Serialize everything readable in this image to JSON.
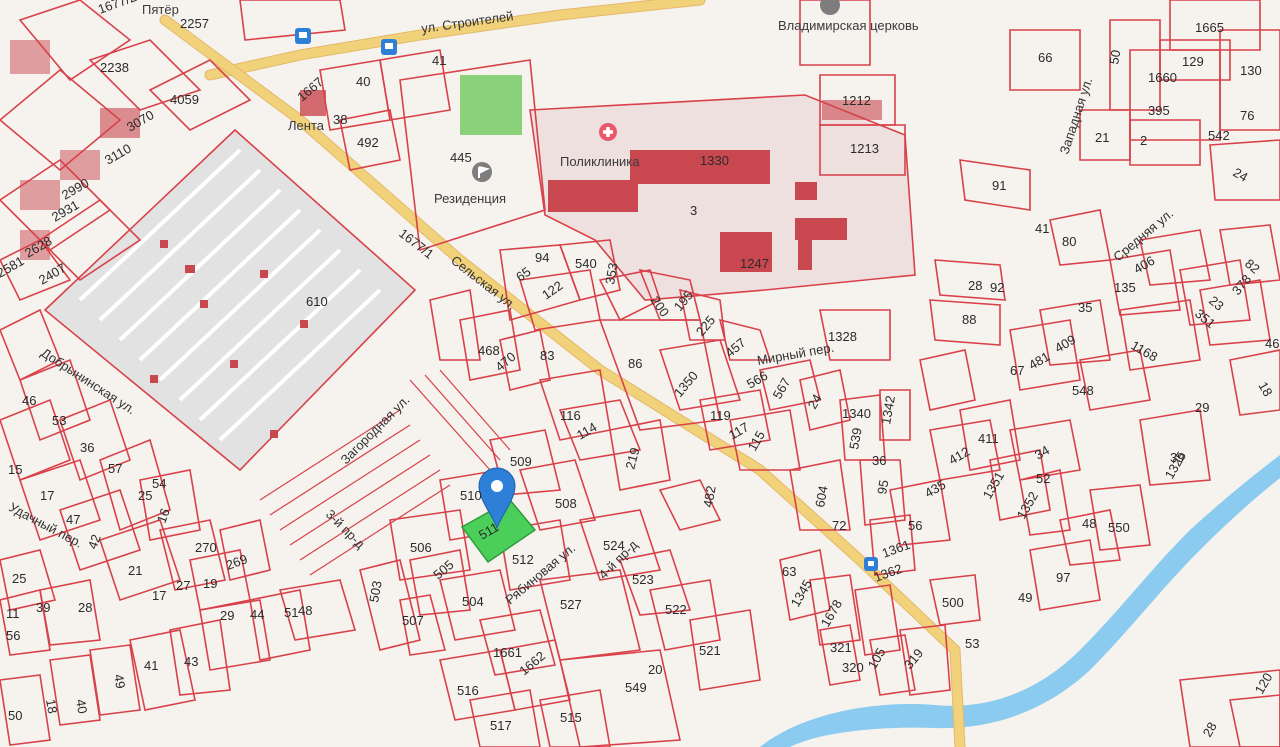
{
  "map": {
    "streets": {
      "stroiteley": "ул. Строителей",
      "selskaya": "Сельская ул.",
      "dobryninskaya": "Добрынинская ул.",
      "mirny": "Мирный пер.",
      "srednyaya": "Средняя ул.",
      "zapadnaya": "Западная ул.",
      "zagorodnaya": "Загородная ул.",
      "udachny": "Удачный пер.",
      "linda": "3-й пр-д",
      "ryabinovaya": "Рябиновая ул.",
      "fourth": "4-й пр-д"
    },
    "pois": {
      "pyaterochka": "Пятёр",
      "lenta": "Лента",
      "polyclinic": "Поликлиника",
      "residence": "Резиденция",
      "church": "Владимирская церковь"
    },
    "parcels": [
      "2257",
      "2238",
      "4059",
      "3070",
      "3110",
      "2990",
      "2931",
      "2628",
      "2581",
      "2407",
      "1677/2",
      "1677/1",
      "1667",
      "38",
      "40",
      "41",
      "445",
      "492",
      "610",
      "65",
      "94",
      "540",
      "353",
      "122",
      "200",
      "195",
      "225",
      "457",
      "1330",
      "3",
      "1247",
      "1212",
      "1213",
      "1328",
      "86",
      "83",
      "470",
      "468",
      "1350",
      "566",
      "567",
      "24",
      "1340",
      "1342",
      "119",
      "117",
      "115",
      "116",
      "114",
      "219",
      "509",
      "508",
      "510",
      "506",
      "505",
      "504",
      "503",
      "507",
      "512",
      "524",
      "523",
      "522",
      "521",
      "527",
      "1661",
      "1662",
      "516",
      "517",
      "515",
      "549",
      "20",
      "482",
      "604",
      "539",
      "36",
      "95",
      "72",
      "1361",
      "1362",
      "1345",
      "1678",
      "321",
      "320",
      "105",
      "319",
      "500",
      "63",
      "53",
      "49",
      "97",
      "550",
      "48",
      "1325",
      "39",
      "411",
      "412",
      "435",
      "1351",
      "1352",
      "34",
      "52",
      "56",
      "409",
      "481",
      "548",
      "1168",
      "135",
      "406",
      "23",
      "351",
      "378",
      "82",
      "18",
      "35",
      "29",
      "46",
      "41",
      "67",
      "80",
      "91",
      "28",
      "92",
      "88",
      "66",
      "50",
      "1660",
      "1665",
      "129",
      "130",
      "76",
      "395",
      "2",
      "21",
      "542",
      "24",
      "46",
      "53",
      "36",
      "15",
      "57",
      "25",
      "54",
      "16",
      "17",
      "47",
      "42",
      "21",
      "25",
      "270",
      "269",
      "19",
      "17",
      "27",
      "39",
      "11",
      "56",
      "28",
      "29",
      "44",
      "48",
      "51",
      "41",
      "43",
      "50",
      "40",
      "49",
      "18",
      "120",
      "28"
    ],
    "selected_parcel": "511",
    "marker": "location-pin",
    "colors": {
      "parcel_line": "#d9414a",
      "building": "#c9474f",
      "road": "#f1d27a",
      "selected": "#4ccf5a",
      "marker": "#2d7fd8",
      "river": "#7fc6ee",
      "park": "#8bd17a"
    }
  }
}
